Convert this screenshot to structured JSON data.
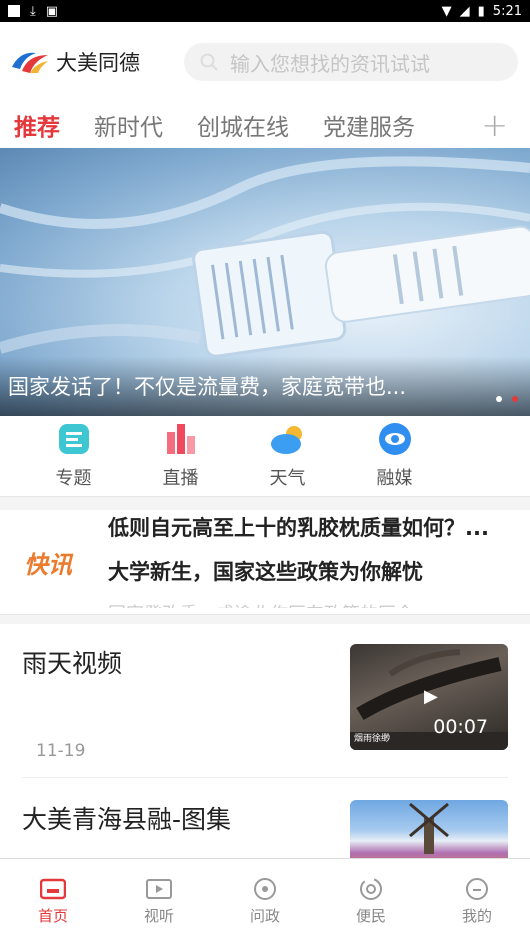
{
  "status_bar": {
    "time": "5:21"
  },
  "header": {
    "app_name": "大美同德",
    "search_placeholder": "输入您想找的资讯试试"
  },
  "tabs": [
    {
      "label": "推荐",
      "active": true
    },
    {
      "label": "新时代",
      "active": false
    },
    {
      "label": "创城在线",
      "active": false
    },
    {
      "label": "党建服务",
      "active": false
    }
  ],
  "banner": {
    "caption": "国家发话了！不仅是流量费，家庭宽带也..."
  },
  "quick_links": [
    {
      "label": "专题",
      "icon": "topic-icon"
    },
    {
      "label": "直播",
      "icon": "live-icon"
    },
    {
      "label": "天气",
      "icon": "weather-icon"
    },
    {
      "label": "融媒",
      "icon": "media-icon"
    }
  ],
  "flash": {
    "tag": "快讯",
    "items": [
      "低则自元高至上十的乳胶枕质量如何？...",
      "大学新生，国家这些政策为你解忧",
      "国家発改委：成渝北作区东政策的区今"
    ]
  },
  "news": [
    {
      "title": "雨天视频",
      "date": "11-19",
      "duration": "00:07",
      "thumb_caption": "烟雨徐缈"
    },
    {
      "title": "大美青海县融-图集"
    }
  ],
  "tabbar": [
    {
      "label": "首页",
      "active": true
    },
    {
      "label": "视听",
      "active": false
    },
    {
      "label": "问政",
      "active": false
    },
    {
      "label": "便民",
      "active": false
    },
    {
      "label": "我的",
      "active": false
    }
  ],
  "colors": {
    "accent": "#e4393c",
    "flash": "#ec7a2c"
  }
}
